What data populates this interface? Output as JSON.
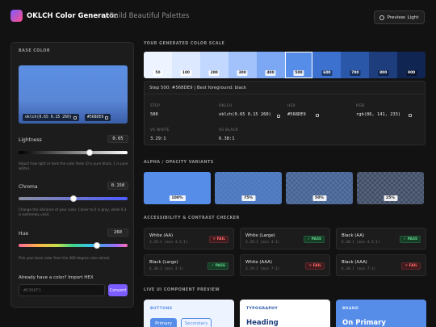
{
  "header": {
    "title": "OKLCH Color Generator",
    "subtitle": "/ Build Beautiful Palettes",
    "preview_button": "Preview: Light"
  },
  "base": {
    "heading": "BASE COLOR",
    "oklch_chip": "oklch(0.65 0.15 260)",
    "hex_chip": "#568DE9",
    "lightness": {
      "label": "Lightness",
      "value": "0.65",
      "help": "Adjust how light or dark the color feels (0 is pure black, 1 is pure white).",
      "fraction": 0.65
    },
    "chroma": {
      "label": "Chroma",
      "value": "0.150",
      "help": "Change the vibrance of your color. Closer to 0 is gray, while 0.3 is extremely vivid.",
      "fraction": 0.5
    },
    "hue": {
      "label": "Hue",
      "value": "260",
      "help": "Pick your base color from the 360-degree color wheel.",
      "fraction": 0.722
    },
    "import_label": "Already have a color? Import HEX",
    "import_placeholder": "#6366F1",
    "convert_button": "Convert"
  },
  "scale": {
    "heading": "YOUR GENERATED COLOR SCALE",
    "steps": [
      {
        "label": "50",
        "color": "#eef4ff",
        "dark": false
      },
      {
        "label": "100",
        "color": "#dde9ff",
        "dark": false
      },
      {
        "label": "200",
        "color": "#c3d8fe",
        "dark": false
      },
      {
        "label": "300",
        "color": "#a2c2fb",
        "dark": false
      },
      {
        "label": "400",
        "color": "#7ca7f3",
        "dark": false
      },
      {
        "label": "500",
        "color": "#568DE9",
        "dark": false
      },
      {
        "label": "600",
        "color": "#3d71cf",
        "dark": true
      },
      {
        "label": "700",
        "color": "#2b57a8",
        "dark": true
      },
      {
        "label": "800",
        "color": "#1d3d7c",
        "dark": true
      },
      {
        "label": "900",
        "color": "#112552",
        "dark": true
      }
    ],
    "active_index": 5
  },
  "detail": {
    "header": "Step 500: #568DE9 | Best foreground: black",
    "step_key": "STEP",
    "step_val": "500",
    "oklch_key": "OKLCH",
    "oklch_val": "oklch(0.65 0.15 260)",
    "hex_key": "HEX",
    "hex_val": "#568DE9",
    "rgb_key": "RGB",
    "rgb_val": "rgb(86, 141, 233)",
    "white_key": "VS WHITE",
    "white_val": "3.29:1",
    "black_key": "VS BLACK",
    "black_val": "6.38:1"
  },
  "alpha": {
    "heading": "ALPHA / OPACITY VARIANTS",
    "items": [
      {
        "label": "100%",
        "opacity": 1.0
      },
      {
        "label": "75%",
        "opacity": 0.75
      },
      {
        "label": "50%",
        "opacity": 0.5
      },
      {
        "label": "25%",
        "opacity": 0.25
      }
    ]
  },
  "contrast": {
    "heading": "ACCESSIBILITY & CONTRAST CHECKER",
    "cards": [
      {
        "title": "White (AA)",
        "sub": "3.29:1 (min 4.5:1)",
        "badge": "✕ FAIL",
        "pass": false
      },
      {
        "title": "White (Large)",
        "sub": "3.29:1 (min 3:1)",
        "badge": "✓ PASS",
        "pass": true
      },
      {
        "title": "Black (AA)",
        "sub": "6.38:1 (min 4.5:1)",
        "badge": "✓ PASS",
        "pass": true
      },
      {
        "title": "Black (Large)",
        "sub": "6.38:1 (min 3:1)",
        "badge": "✓ PASS",
        "pass": true
      },
      {
        "title": "White (AAA)",
        "sub": "3.29:1 (min 7:1)",
        "badge": "✕ FAIL",
        "pass": false
      },
      {
        "title": "Black (AAA)",
        "sub": "6.38:1 (min 7:1)",
        "badge": "✕ FAIL",
        "pass": false
      }
    ]
  },
  "preview": {
    "heading": "LIVE UI COMPONENT PREVIEW",
    "buttons_heading": "BUTTONS",
    "primary": "Primary",
    "secondary": "Secondary",
    "typography_heading": "TYPOGRAPHY",
    "typography_sample": "Heading",
    "brand_heading": "BRAND",
    "brand_sample": "On Primary"
  },
  "colors": {
    "accent": "#7a5cff",
    "base": "#568DE9"
  }
}
